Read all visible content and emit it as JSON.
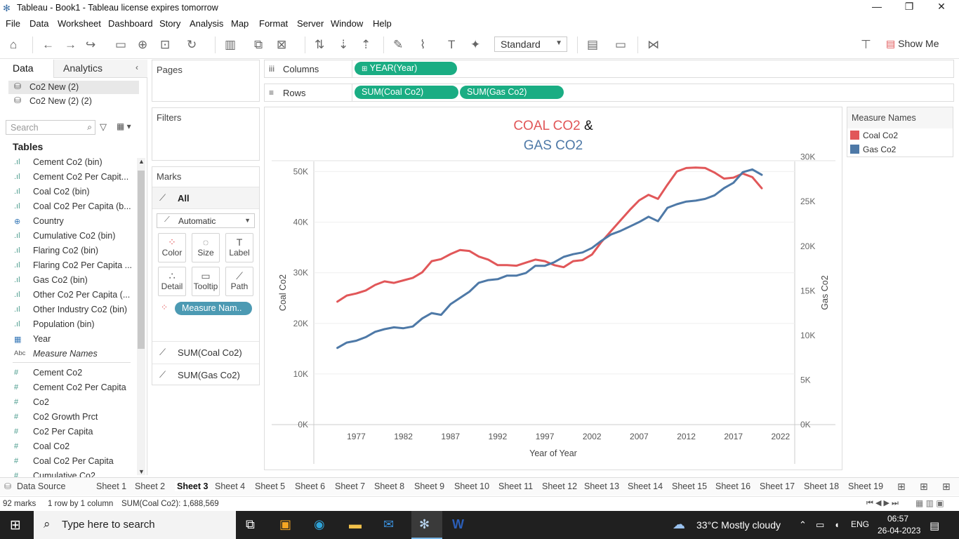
{
  "window": {
    "title": "Tableau - Book1 - Tableau license expires tomorrow"
  },
  "menu": [
    "File",
    "Data",
    "Worksheet",
    "Dashboard",
    "Story",
    "Analysis",
    "Map",
    "Format",
    "Server",
    "Window",
    "Help"
  ],
  "toolbar": {
    "fit_mode": "Standard",
    "show_me": "Show Me"
  },
  "datapane": {
    "tab_data": "Data",
    "tab_analytics": "Analytics",
    "sources": [
      "Co2 New (2)",
      "Co2 New (2) (2)"
    ],
    "search_placeholder": "Search",
    "tables_header": "Tables",
    "dimensions": [
      {
        "icon": "bin-icon",
        "label": "Cement Co2 (bin)"
      },
      {
        "icon": "bin-icon",
        "label": "Cement Co2 Per Capit..."
      },
      {
        "icon": "bin-icon",
        "label": "Coal Co2 (bin)"
      },
      {
        "icon": "bin-icon",
        "label": "Coal Co2 Per Capita (b..."
      },
      {
        "icon": "globe-icon",
        "label": "Country"
      },
      {
        "icon": "bin-icon",
        "label": "Cumulative Co2 (bin)"
      },
      {
        "icon": "bin-icon",
        "label": "Flaring Co2 (bin)"
      },
      {
        "icon": "bin-icon",
        "label": "Flaring Co2 Per Capita ..."
      },
      {
        "icon": "bin-icon",
        "label": "Gas Co2 (bin)"
      },
      {
        "icon": "bin-icon",
        "label": "Other Co2 Per Capita (..."
      },
      {
        "icon": "bin-icon",
        "label": "Other Industry Co2 (bin)"
      },
      {
        "icon": "bin-icon",
        "label": "Population (bin)"
      },
      {
        "icon": "calendar-icon",
        "label": "Year"
      },
      {
        "icon": "abc-icon",
        "label": "Measure Names"
      }
    ],
    "measures": [
      "Cement Co2",
      "Cement Co2 Per Capita",
      "Co2",
      "Co2 Growth Prct",
      "Co2 Per Capita",
      "Coal Co2",
      "Coal Co2 Per Capita",
      "Cumulative Co2"
    ]
  },
  "shelves": {
    "pages_label": "Pages",
    "filters_label": "Filters",
    "columns_label": "Columns",
    "rows_label": "Rows",
    "columns_pills": [
      "YEAR(Year)"
    ],
    "rows_pills": [
      "SUM(Coal Co2)",
      "SUM(Gas Co2)"
    ]
  },
  "marks": {
    "label": "Marks",
    "all": "All",
    "type": "Automatic",
    "buttons": [
      "Color",
      "Size",
      "Label",
      "Detail",
      "Tooltip",
      "Path"
    ],
    "color_pill": "Measure Nam..",
    "sections": [
      "SUM(Coal Co2)",
      "SUM(Gas Co2)"
    ]
  },
  "legend": {
    "title": "Measure Names",
    "items": [
      {
        "label": "Coal Co2",
        "color": "#e15759"
      },
      {
        "label": "Gas Co2",
        "color": "#4e79a7"
      }
    ]
  },
  "chart_data": {
    "type": "line",
    "title_part1": "COAL CO2",
    "title_amp": "&",
    "title_part2": "GAS CO2",
    "xlabel": "Year of Year",
    "ylabel_left": "Coal Co2",
    "ylabel_right": "Gas Co2",
    "x_ticks": [
      "1977",
      "1982",
      "1987",
      "1992",
      "1997",
      "2002",
      "2007",
      "2012",
      "2017",
      "2022"
    ],
    "y_left_ticks": [
      "0K",
      "10K",
      "20K",
      "30K",
      "40K",
      "50K"
    ],
    "y_right_ticks": [
      "0K",
      "5K",
      "10K",
      "15K",
      "20K",
      "25K",
      "30K"
    ],
    "x_range": [
      1972.5,
      2023.5
    ],
    "y_left_range": [
      0,
      52000
    ],
    "y_right_range": [
      0,
      29500
    ],
    "x": [
      1975,
      1976,
      1977,
      1978,
      1979,
      1980,
      1981,
      1982,
      1983,
      1984,
      1985,
      1986,
      1987,
      1988,
      1989,
      1990,
      1991,
      1992,
      1993,
      1994,
      1995,
      1996,
      1997,
      1998,
      1999,
      2000,
      2001,
      2002,
      2003,
      2004,
      2005,
      2006,
      2007,
      2008,
      2009,
      2010,
      2011,
      2012,
      2013,
      2014,
      2015,
      2016,
      2017,
      2018,
      2019,
      2020
    ],
    "series": [
      {
        "name": "Coal Co2",
        "axis": "left",
        "color": "#e15759",
        "values": [
          24300,
          25500,
          25900,
          26500,
          27600,
          28300,
          28000,
          28500,
          29000,
          30100,
          32300,
          32700,
          33700,
          34500,
          34300,
          33200,
          32600,
          31500,
          31500,
          31400,
          32000,
          32600,
          32300,
          31500,
          31100,
          32300,
          32500,
          33600,
          36100,
          38200,
          40300,
          42400,
          44300,
          45400,
          44600,
          47400,
          50000,
          50700,
          50800,
          50700,
          49800,
          48600,
          48800,
          49600,
          48900,
          46700
        ]
      },
      {
        "name": "Gas Co2",
        "axis": "right",
        "color": "#4e79a7",
        "values": [
          8600,
          9200,
          9400,
          9800,
          10400,
          10700,
          10900,
          10800,
          11000,
          11900,
          12500,
          12300,
          13500,
          14200,
          14900,
          15900,
          16200,
          16300,
          16700,
          16700,
          17000,
          17800,
          17800,
          18200,
          18800,
          19100,
          19300,
          19800,
          20600,
          21300,
          21700,
          22200,
          22700,
          23300,
          22800,
          24300,
          24700,
          25000,
          25100,
          25300,
          25700,
          26500,
          27100,
          28300,
          28600,
          28000
        ]
      }
    ]
  },
  "sheet_tabs": [
    "Data Source",
    "Sheet 1",
    "Sheet 2",
    "Sheet 3",
    "Sheet 4",
    "Sheet 5",
    "Sheet 6",
    "Sheet 7",
    "Sheet 8",
    "Sheet 9",
    "Sheet 10",
    "Sheet 11",
    "Sheet 12",
    "Sheet 13",
    "Sheet 14",
    "Sheet 15",
    "Sheet 16",
    "Sheet 17",
    "Sheet 18",
    "Sheet 19"
  ],
  "active_sheet": "Sheet 3",
  "status": {
    "marks": "92 marks",
    "dims": "1 row by 1 column",
    "sum": "SUM(Coal Co2): 1,688,569"
  },
  "taskbar": {
    "search_placeholder": "Type here to search",
    "weather": "33°C  Mostly cloudy",
    "lang": "ENG",
    "time": "06:57",
    "date": "26-04-2023"
  }
}
